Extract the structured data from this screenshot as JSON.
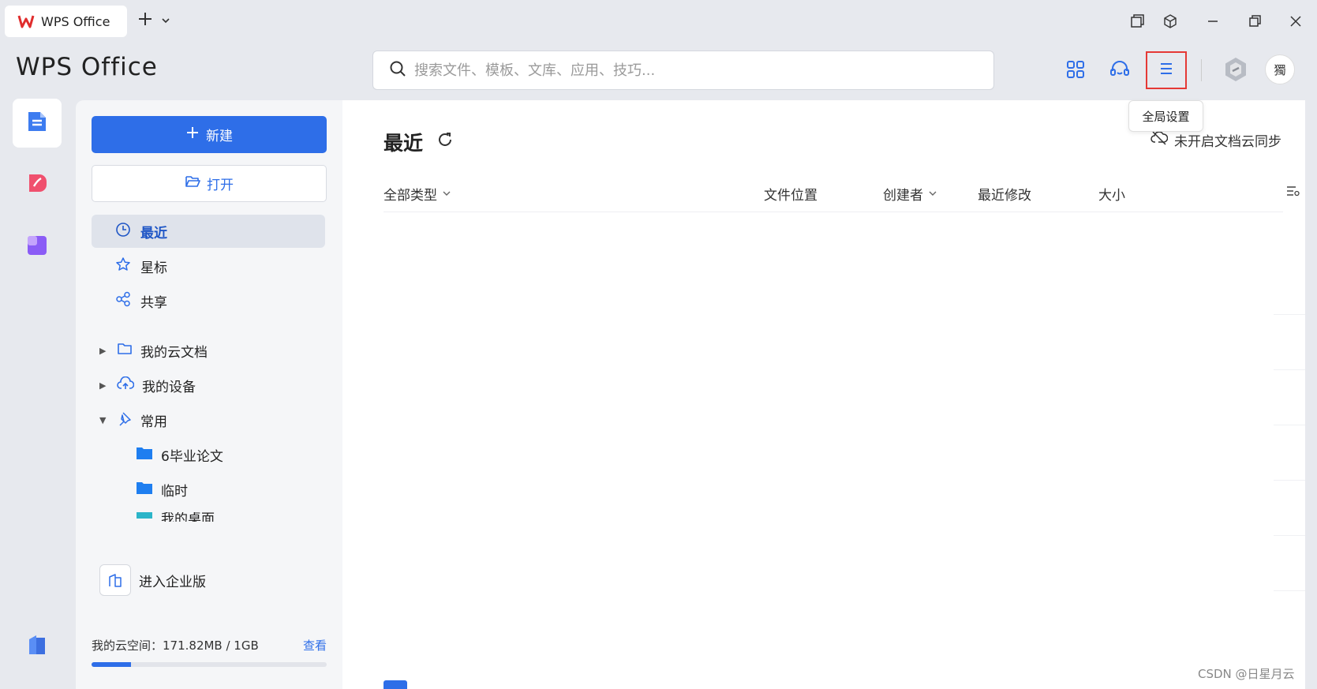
{
  "titlebar": {
    "tab_label": "WPS Office",
    "tab_logo": "W"
  },
  "header": {
    "brand": "WPS Office",
    "search_placeholder": "搜索文件、模板、文库、应用、技巧...",
    "tooltip": "全局设置",
    "avatar_text": "獨"
  },
  "sidebar": {
    "new_label": "新建",
    "open_label": "打开",
    "nav": [
      {
        "label": "最近"
      },
      {
        "label": "星标"
      },
      {
        "label": "共享"
      }
    ],
    "tree": [
      {
        "label": "我的云文档",
        "caret": "▶"
      },
      {
        "label": "我的设备",
        "caret": "▶"
      },
      {
        "label": "常用",
        "caret": "▼"
      }
    ],
    "folders": [
      {
        "label": "6毕业论文"
      },
      {
        "label": "临时"
      },
      {
        "label": "我的桌面"
      }
    ],
    "enterprise_label": "进入企业版",
    "space_label": "我的云空间：171.82MB / 1GB",
    "space_view": "查看",
    "space_used_fraction": 0.168
  },
  "main": {
    "title": "最近",
    "sync_label": "未开启文档云同步",
    "columns": {
      "type": "全部类型",
      "location": "文件位置",
      "creator": "创建者",
      "modified": "最近修改",
      "size": "大小"
    }
  },
  "watermark": "CSDN @日星月云",
  "colors": {
    "accent": "#2e6ee8",
    "highlight": "#e53935"
  }
}
